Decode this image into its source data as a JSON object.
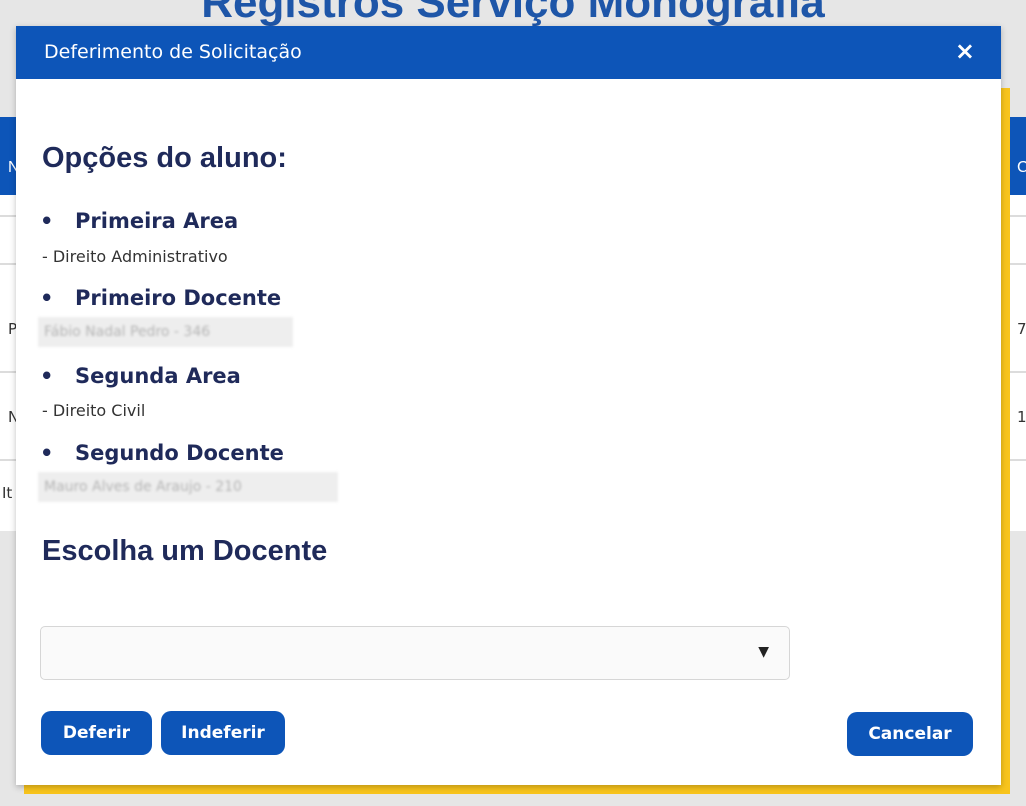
{
  "background": {
    "page_title": "Registros Serviço Monografia",
    "header_left": "N",
    "header_right": "C",
    "rows": [
      {
        "left": "P",
        "right": "7"
      },
      {
        "left": "N",
        "right": "1"
      }
    ],
    "footer_left": "It"
  },
  "modal": {
    "title": "Deferimento de Solicitação",
    "close_glyph": "×",
    "options_heading": "Opções do aluno:",
    "options": [
      {
        "label": "Primeira Area",
        "detail": "- Direito Administrativo"
      },
      {
        "label": "Primeiro Docente",
        "detail": "Fábio Nadal Pedro - 346"
      },
      {
        "label": "Segunda Area",
        "detail": "- Direito Civil"
      },
      {
        "label": "Segundo Docente",
        "detail": "Mauro Alves de Araujo - 210"
      }
    ],
    "choose_heading": "Escolha um Docente",
    "select": {
      "value": "",
      "arrow": "▼"
    },
    "buttons": {
      "approve": "Deferir",
      "reject": "Indeferir",
      "cancel": "Cancelar"
    }
  },
  "colors": {
    "primary": "#0d55b8",
    "accent": "#f8c41c",
    "heading": "#1f2a5a"
  }
}
